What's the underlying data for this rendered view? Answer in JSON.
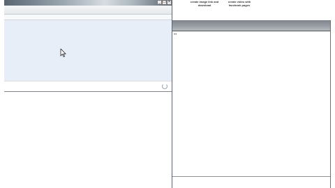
{
  "left_window": {
    "titlebar_buttons": [
      "_",
      "□",
      "×"
    ]
  },
  "right_window": {
    "notes": [
      "create image link and download",
      "create video with facebook pages"
    ],
    "small_label": "▪▪▪"
  }
}
